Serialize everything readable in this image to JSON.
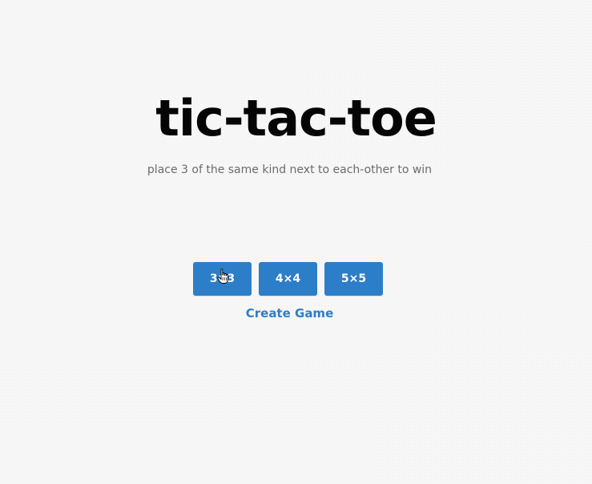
{
  "header": {
    "title": "tic-tac-toe",
    "subtitle": "place 3 of the same kind next to each-other to win"
  },
  "board_sizes": [
    {
      "label": "3×3"
    },
    {
      "label": "4×4"
    },
    {
      "label": "5×5"
    }
  ],
  "create_game": {
    "label": "Create Game"
  },
  "colors": {
    "accent": "#2d7ec9",
    "title": "#050505",
    "subtitle": "#6b6b6b",
    "background": "#f7f7f7"
  },
  "pointer": {
    "icon": "hand-pointer-icon"
  }
}
